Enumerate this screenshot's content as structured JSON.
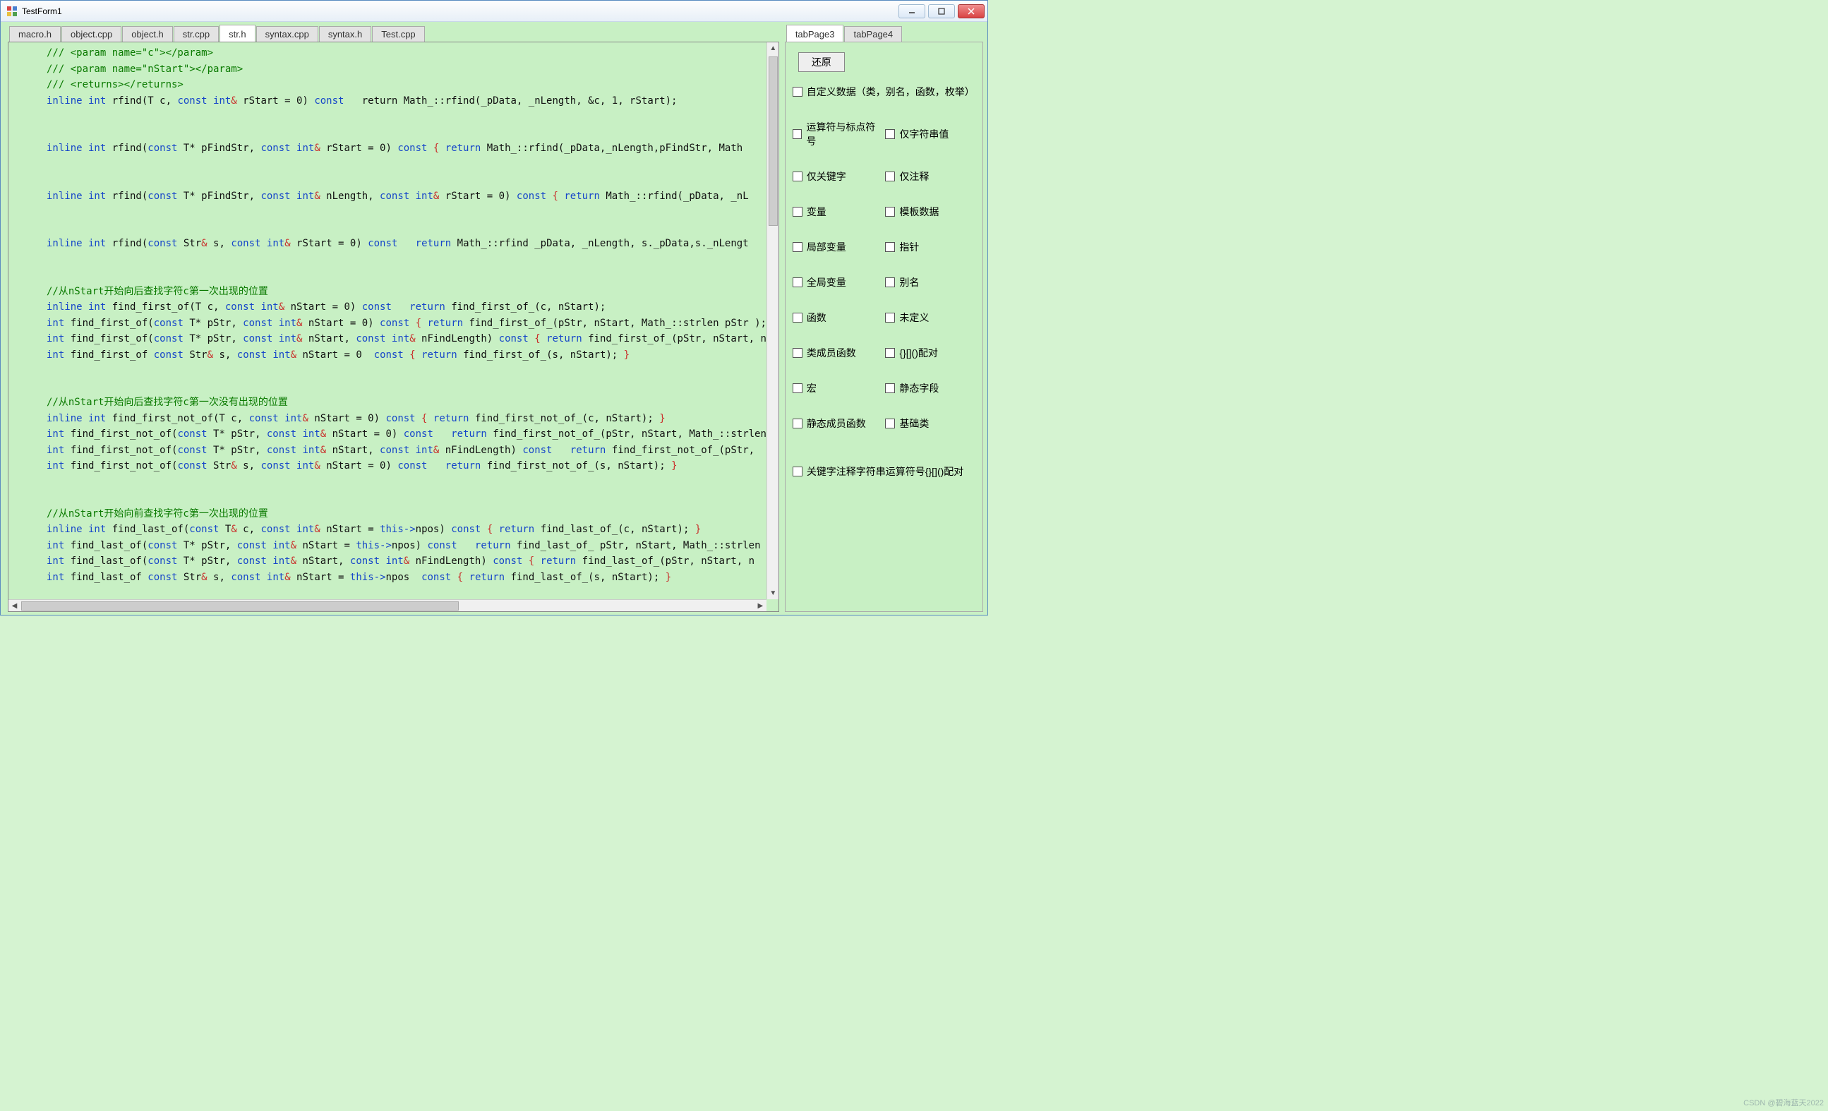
{
  "window": {
    "title": "TestForm1"
  },
  "left": {
    "tabs": [
      "macro.h",
      "object.cpp",
      "object.h",
      "str.cpp",
      "str.h",
      "syntax.cpp",
      "syntax.h",
      "Test.cpp"
    ],
    "activeTab": 4,
    "code": {
      "l01a": "/// <param name=\"c\"></param>",
      "l01": "/// <param name=\"nStart\"></param>",
      "l02": "/// <returns></returns>",
      "l03_pre": "inline int ",
      "l03_rfind": "rfind(T c, ",
      "l03_kw1": "const int",
      "l03_mid": " rStart = 0) ",
      "l03_kw2": "const",
      "l03_post": "   return Math_::rfind(_pData, _nLength, &c, 1, rStart);",
      "l05_pre": "inline int ",
      "l05_a": "rfind(",
      "l05_kw1": "const ",
      "l05_b": "T* pFindStr, ",
      "l05_kw2": "const int",
      "l05_c": " rStart = 0) ",
      "l05_kw3": "const ",
      "l05_br1": "{ ",
      "l05_kw4": "return ",
      "l05_d": "Math_::rfind(_pData,_nLength,pFindStr, Math",
      "l07_pre": "inline int ",
      "l07_a": "rfind(",
      "l07_kw1": "const ",
      "l07_b": "T* pFindStr, ",
      "l07_kw2": "const int",
      "l07_c": " nLength, ",
      "l07_kw3": "const int",
      "l07_d": " rStart = 0) ",
      "l07_kw4": "const ",
      "l07_br1": "{ ",
      "l07_kw5": "return ",
      "l07_e": "Math_::rfind(_pData, _nL",
      "l09_pre": "inline int ",
      "l09_a": "rfind(",
      "l09_kw1": "const ",
      "l09_b": "Str",
      "l09_c": " s, ",
      "l09_kw2": "const int",
      "l09_d": " rStart = 0) ",
      "l09_kw3": "const ",
      "l09_kw4": "  return ",
      "l09_e": "Math_::rfind _pData, _nLength, s._pData,s._nLengt",
      "c1": "//从nStart开始向后查找字符c第一次出现的位置",
      "f1a_pre": "inline int ",
      "f1a_a": "find_first_of(T c, ",
      "f1a_kw1": "const int",
      "f1a_b": " nStart = 0) ",
      "f1a_kw2": "const ",
      "f1a_kw3": "  return ",
      "f1a_c": "find_first_of_(c, nStart);",
      "f1b_pre": "int ",
      "f1b_a": "find_first_of(",
      "f1b_kw1": "const ",
      "f1b_b": "T* pStr, ",
      "f1b_kw2": "const int",
      "f1b_c": " nStart = 0) ",
      "f1b_kw3": "const ",
      "f1b_br1": "{ ",
      "f1b_kw4": "return ",
      "f1b_d": "find_first_of_(pStr, nStart, Math_::strlen pStr ); ",
      "f1b_br2": "}",
      "f1c_pre": "int ",
      "f1c_a": "find_first_of(",
      "f1c_kw1": "const ",
      "f1c_b": "T* pStr, ",
      "f1c_kw2": "const int",
      "f1c_c": " nStart, ",
      "f1c_kw3": "const int",
      "f1c_d": " nFindLength) ",
      "f1c_kw4": "const ",
      "f1c_br1": "{ ",
      "f1c_kw5": "return ",
      "f1c_e": "find_first_of_(pStr, nStart, n",
      "f1d_pre": "int ",
      "f1d_a": "find_first_of ",
      "f1d_kw1": "const ",
      "f1d_b": "Str",
      "f1d_c": " s, ",
      "f1d_kw2": "const int",
      "f1d_d": " nStart = 0  ",
      "f1d_kw3": "const ",
      "f1d_br1": "{ ",
      "f1d_kw4": "return ",
      "f1d_e": "find_first_of_(s, nStart); ",
      "f1d_br2": "}",
      "c2": "//从nStart开始向后查找字符c第一次没有出现的位置",
      "n1a_pre": "inline int ",
      "n1a_a": "find_first_not_of(T c, ",
      "n1a_kw1": "const int",
      "n1a_b": " nStart = 0) ",
      "n1a_kw2": "const ",
      "n1a_br1": "{ ",
      "n1a_kw3": "return ",
      "n1a_c": "find_first_not_of_(c, nStart); ",
      "n1a_br2": "}",
      "n1b_pre": "int ",
      "n1b_a": "find_first_not_of(",
      "n1b_kw1": "const ",
      "n1b_b": "T* pStr, ",
      "n1b_kw2": "const int",
      "n1b_c": " nStart = 0) ",
      "n1b_kw3": "const ",
      "n1b_kw4": "  return ",
      "n1b_d": "find_first_not_of_(pStr, nStart, Math_::strlen",
      "n1c_pre": "int ",
      "n1c_a": "find_first_not_of(",
      "n1c_kw1": "const ",
      "n1c_b": "T* pStr, ",
      "n1c_kw2": "const int",
      "n1c_c": " nStart, ",
      "n1c_kw3": "const int",
      "n1c_d": " nFindLength) ",
      "n1c_kw4": "const ",
      "n1c_kw5": "  return ",
      "n1c_e": "find_first_not_of_(pStr,",
      "n1d_pre": "int ",
      "n1d_a": "find_first_not_of(",
      "n1d_kw1": "const ",
      "n1d_b": "Str",
      "n1d_c": " s, ",
      "n1d_kw2": "const int",
      "n1d_d": " nStart = 0) ",
      "n1d_kw3": "const ",
      "n1d_kw4": "  return ",
      "n1d_e": "find_first_not_of_(s, nStart); ",
      "n1d_br2": "}",
      "c3": "//从nStart开始向前查找字符c第一次出现的位置",
      "L1a_pre": "inline int ",
      "L1a_a": "find_last_of(",
      "L1a_kw1": "const ",
      "L1a_b": "T",
      "L1a_c": " c, ",
      "L1a_kw2": "const int",
      "L1a_d": " nStart = ",
      "L1a_kw3": "this->",
      "L1a_e": "npos) ",
      "L1a_kw4": "const ",
      "L1a_br1": "{ ",
      "L1a_kw5": "return ",
      "L1a_f": "find_last_of_(c, nStart); ",
      "L1a_br2": "}",
      "L1b_pre": "int ",
      "L1b_a": "find_last_of(",
      "L1b_kw1": "const ",
      "L1b_b": "T* pStr, ",
      "L1b_kw2": "const int",
      "L1b_c": " nStart = ",
      "L1b_kw3": "this->",
      "L1b_d": "npos) ",
      "L1b_kw4": "const ",
      "L1b_kw5": "  return ",
      "L1b_e": "find_last_of_ pStr, nStart, Math_::strlen",
      "L1c_pre": "int ",
      "L1c_a": "find_last_of(",
      "L1c_kw1": "const ",
      "L1c_b": "T* pStr, ",
      "L1c_kw2": "const int",
      "L1c_c": " nStart, ",
      "L1c_kw3": "const int",
      "L1c_d": " nFindLength) ",
      "L1c_kw4": "const ",
      "L1c_br1": "{ ",
      "L1c_kw5": "return ",
      "L1c_e": "find_last_of_(pStr, nStart, n",
      "L1d_pre": "int ",
      "L1d_a": "find_last_of ",
      "L1d_kw1": "const ",
      "L1d_b": "Str",
      "L1d_c": " s, ",
      "L1d_kw2": "const int",
      "L1d_d": " nStart = ",
      "L1d_kw3": "this->",
      "L1d_e": "npos  ",
      "L1d_kw4": "const ",
      "L1d_br1": "{ ",
      "L1d_kw5": "return ",
      "L1d_f": "find_last_of_(s, nStart); ",
      "L1d_br2": "}"
    }
  },
  "right": {
    "tabs": [
      "tabPage3",
      "tabPage4"
    ],
    "activeTab": 0,
    "restore": "还原",
    "checks_wide": [
      "自定义数据（类，别名，函数，枚举）"
    ],
    "checks_grid": [
      "运算符与标点符号",
      "仅字符串值",
      "仅关键字",
      "仅注释",
      "变量",
      "模板数据",
      "局部变量",
      "指针",
      "全局变量",
      "别名",
      "函数",
      "未定义",
      "类成员函数",
      "{}[]()配对",
      "宏",
      "静态字段",
      "静态成员函数",
      "基础类"
    ],
    "checks_bottom": [
      "关键字注释字符串运算符号{}[]()配对"
    ]
  },
  "watermark": "CSDN @碧海蓝天2022"
}
